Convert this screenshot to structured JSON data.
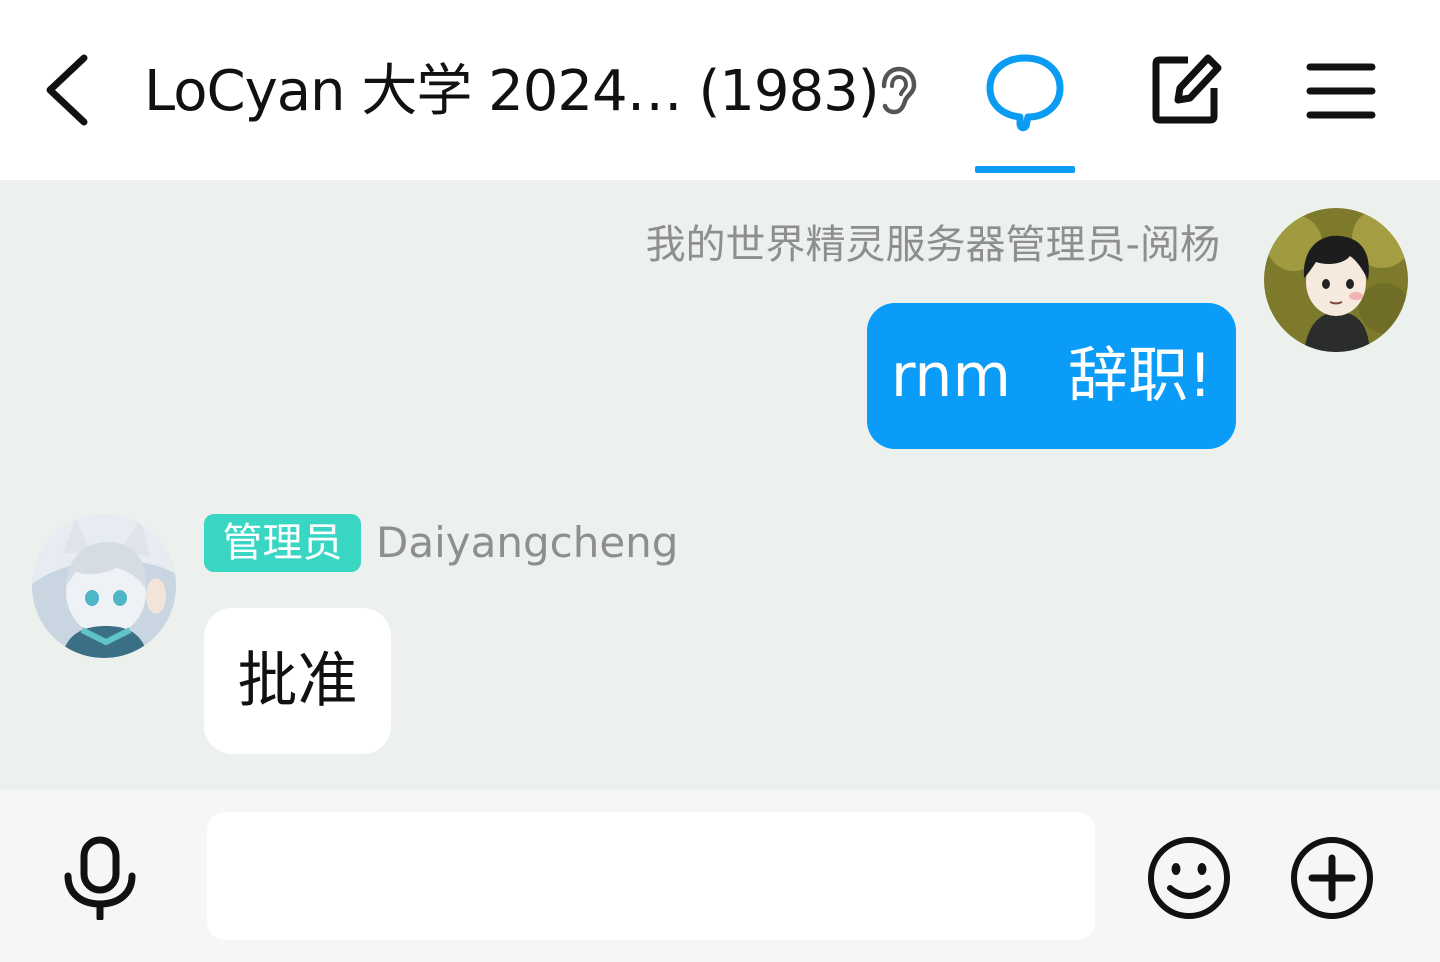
{
  "header": {
    "title": "LoCyan 大学 2024…  (1983)",
    "icons": {
      "back": "chevron-left-icon",
      "listen": "ear-icon",
      "chat": "chat-bubble-icon",
      "edit": "edit-square-icon",
      "menu": "hamburger-menu-icon"
    },
    "accent_color": "#0a9cf3"
  },
  "messages": [
    {
      "side": "right",
      "sender": "我的世界精灵服务器管理员-阅杨",
      "text": "rnm   辞职!",
      "bubble_color": "#0a9cf6"
    },
    {
      "side": "left",
      "role": "管理员",
      "role_color": "#3ad6c4",
      "sender": "Daiyangcheng",
      "text": "批准"
    }
  ],
  "input_bar": {
    "placeholder": "",
    "icons": {
      "voice": "microphone-icon",
      "emoji": "smiley-icon",
      "more": "plus-circle-icon"
    }
  }
}
